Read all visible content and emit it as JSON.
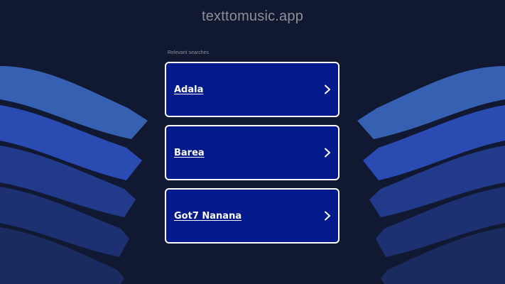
{
  "site": {
    "domain": "texttomusic.app"
  },
  "search": {
    "heading": "Relevant searches",
    "results": [
      {
        "label": "Adala",
        "icon": "chevron-right-icon"
      },
      {
        "label": "Barea",
        "icon": "chevron-right-icon"
      },
      {
        "label": "Got7 Nanana",
        "icon": "chevron-right-icon"
      }
    ]
  },
  "colors": {
    "background": "#111831",
    "card_fill": "#021a8c",
    "card_border": "#ffffff",
    "wave_1": "#3660b2",
    "wave_2": "#2a4bb1",
    "wave_3": "#213b8a",
    "wave_4": "#1c3072",
    "wave_5": "#1a2b60"
  }
}
